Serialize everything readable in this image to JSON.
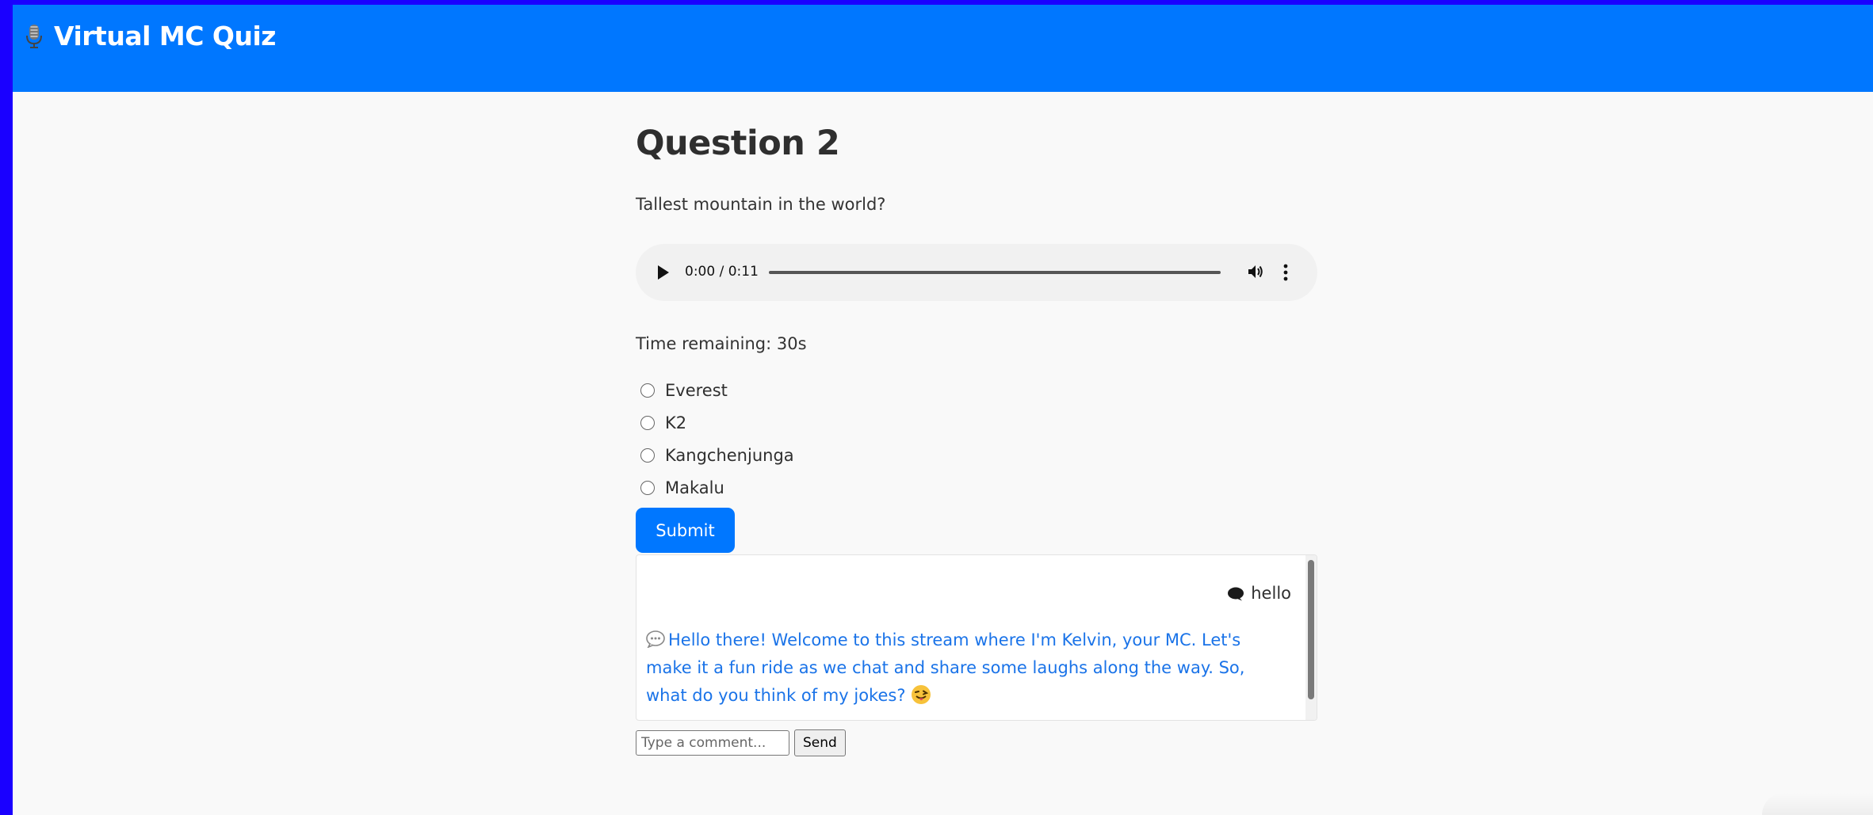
{
  "header": {
    "title": "Virtual MC Quiz",
    "icon": "microphone-icon",
    "color": "#0077ff"
  },
  "question": {
    "title": "Question 2",
    "text": "Tallest mountain in the world?"
  },
  "audio": {
    "time": "0:00 / 0:11",
    "progress_percent": 0
  },
  "timer": {
    "text": "Time remaining: 30s"
  },
  "options": [
    "Everest",
    "K2",
    "Kangchenjunga",
    "Makalu"
  ],
  "submit_label": "Submit",
  "chat": {
    "user_message": "hello",
    "bot_message": "Hello there! Welcome to this stream where I'm Kelvin, your MC. Let's make it a fun ride as we chat and share some laughs along the way. So, what do you think of my jokes?",
    "bot_color": "#1a73e8"
  },
  "comment": {
    "placeholder": "Type a comment...",
    "send_label": "Send"
  }
}
